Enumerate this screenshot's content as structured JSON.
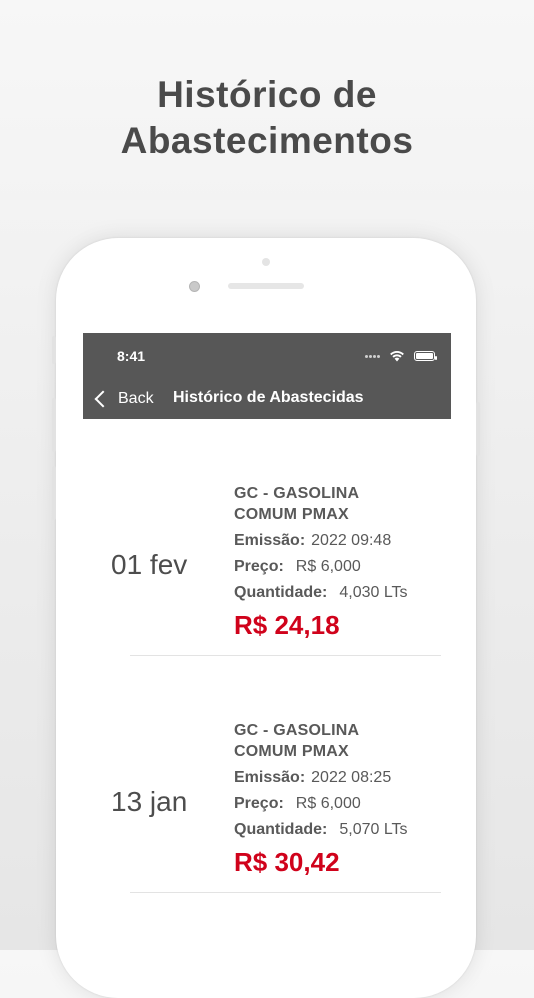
{
  "promo": {
    "title_line1": "Histórico de",
    "title_line2": "Abastecimentos"
  },
  "status_bar": {
    "time": "8:41",
    "icons": [
      "signal-icon",
      "wifi-icon",
      "battery-icon"
    ]
  },
  "nav": {
    "back_label": "Back",
    "back_icon": "chevron-left-icon",
    "title": "Histórico de Abastecidas"
  },
  "colors": {
    "header_bg": "#575757",
    "total_red": "#d0021b",
    "text_gray": "#595959"
  },
  "records": [
    {
      "date": "01 fev",
      "fuel_line1": "GC - GASOLINA",
      "fuel_line2": "COMUM PMAX",
      "emission_label": "Emissão:",
      "emission_value": "2022 09:48",
      "price_label": "Preço:",
      "price_value": "R$ 6,000",
      "quantity_label": "Quantidade:",
      "quantity_value": "4,030 LTs",
      "total": "R$ 24,18"
    },
    {
      "date": "13 jan",
      "fuel_line1": "GC - GASOLINA",
      "fuel_line2": "COMUM PMAX",
      "emission_label": "Emissão:",
      "emission_value": "2022 08:25",
      "price_label": "Preço:",
      "price_value": "R$ 6,000",
      "quantity_label": "Quantidade:",
      "quantity_value": "5,070 LTs",
      "total": "R$ 30,42"
    }
  ]
}
